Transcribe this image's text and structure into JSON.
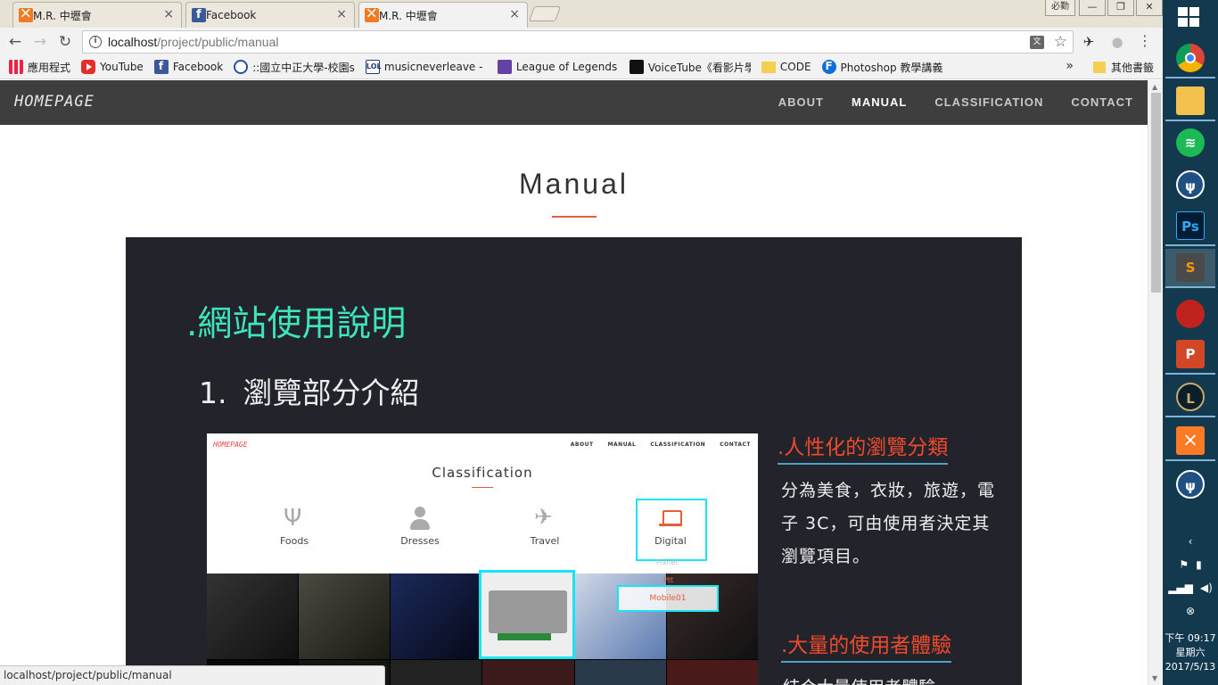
{
  "browser": {
    "tabs": [
      {
        "title": "M.R. 中壢會",
        "favicon": "xampp-icon",
        "active": false
      },
      {
        "title": "Facebook",
        "favicon": "facebook-icon",
        "active": false
      },
      {
        "title": "M.R. 中壢會",
        "favicon": "xampp-icon",
        "active": true
      }
    ],
    "tab_close_glyph": "×",
    "user_chip": "必勤",
    "window_controls": {
      "minimize": "—",
      "maximize": "❐",
      "close": "✕"
    },
    "url_host": "localhost",
    "url_path": "/project/public/manual",
    "bookmarks": [
      {
        "label": "應用程式",
        "icon": "apps-grid-icon"
      },
      {
        "label": "YouTube",
        "icon": "youtube-icon"
      },
      {
        "label": "Facebook",
        "icon": "facebook-icon"
      },
      {
        "label": "::國立中正大學-校園s",
        "icon": "university-icon"
      },
      {
        "label": "musicneverleave - LC",
        "icon": "lol-icon"
      },
      {
        "label": "League of Legends -",
        "icon": "twitch-icon"
      },
      {
        "label": "VoiceTube《看影片學",
        "icon": "voicetube-icon"
      },
      {
        "label": "CODE",
        "icon": "folder-icon"
      },
      {
        "label": "Photoshop 教學講義",
        "icon": "photoshop-icon"
      }
    ],
    "bookmarks_more": "»",
    "other_bookmarks": "其他書籤",
    "status_url": "localhost/project/public/manual"
  },
  "site": {
    "logo": "HOMEPAGE",
    "nav": [
      {
        "label": "ABOUT",
        "current": false
      },
      {
        "label": "MANUAL",
        "current": true
      },
      {
        "label": "CLASSIFICATION",
        "current": false
      },
      {
        "label": "CONTACT",
        "current": false
      }
    ],
    "heading": "Manual",
    "accent_color": "#e0603c",
    "panel_color": "#22232b",
    "section_title": ".網站使用說明",
    "sub_number": "1.",
    "sub_title": "瀏覽部分介紹",
    "screenshot": {
      "logo": "HOMEPAGE",
      "nav": [
        "ABOUT",
        "MANUAL",
        "CLASSIFICATION",
        "CONTACT"
      ],
      "heading": "Classification",
      "categories": [
        {
          "label": "Foods",
          "icon": "fork-knife-icon"
        },
        {
          "label": "Dresses",
          "icon": "user-icon"
        },
        {
          "label": "Travel",
          "icon": "plane-icon"
        },
        {
          "label": "Digital",
          "icon": "laptop-icon"
        }
      ],
      "dropdown": [
        "Pixnet",
        "Ptt",
        "Mobile01"
      ]
    },
    "features": [
      {
        "title": ".人性化的瀏覽分類",
        "body": "分為美食，衣妝，旅遊，電子 3C，可由使用者決定其瀏覽項目。"
      },
      {
        "title": ".大量的使用者體驗",
        "body": "結合大量使用者體驗"
      }
    ]
  },
  "taskbar": {
    "apps": [
      {
        "name": "chrome",
        "icon": "chrome-icon"
      },
      {
        "name": "file-explorer",
        "icon": "folder-icon"
      },
      {
        "name": "spotify",
        "icon": "spotify-icon"
      },
      {
        "name": "sourcetree",
        "icon": "sourcetree-icon"
      },
      {
        "name": "photoshop",
        "icon": "photoshop-icon",
        "label": "Ps"
      },
      {
        "name": "sublime",
        "icon": "sublime-icon",
        "label": "S"
      },
      {
        "name": "app-red",
        "icon": "red-bag-icon"
      },
      {
        "name": "powerpoint",
        "icon": "powerpoint-icon",
        "label": "P"
      },
      {
        "name": "league",
        "icon": "league-icon",
        "label": "L"
      },
      {
        "name": "xampp",
        "icon": "xampp-icon"
      },
      {
        "name": "sourcetree-2",
        "icon": "sourcetree-icon"
      }
    ],
    "time": "下午 09:17",
    "weekday": "星期六",
    "date": "2017/5/13"
  }
}
